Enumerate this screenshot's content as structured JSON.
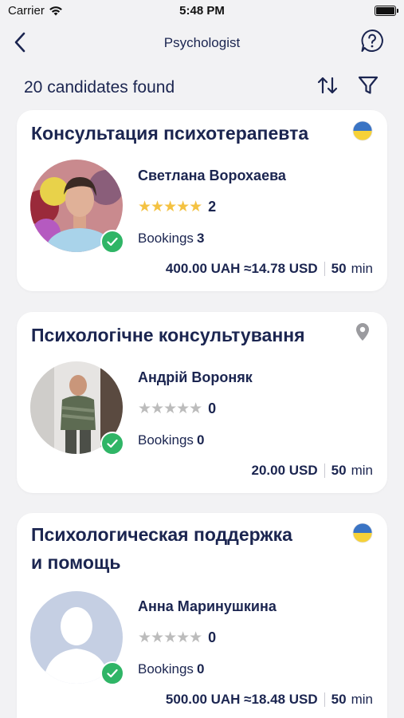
{
  "status_bar": {
    "carrier": "Carrier",
    "time": "5:48 PM"
  },
  "nav": {
    "title": "Psychologist"
  },
  "results": {
    "count_label": "20 candidates found"
  },
  "cards": [
    {
      "title": "Консультация психотерапевта",
      "badge": "ukraine-flag-icon",
      "name": "Светлана Ворохаева",
      "stars": 5,
      "reviews": "2",
      "bookings_label": "Bookings",
      "bookings_count": "3",
      "price": "400.00 UAH ≈14.78 USD",
      "duration": "50",
      "duration_unit": "min"
    },
    {
      "title": "Психологічне консультування",
      "badge": "location-pin-icon",
      "name": "Андрій Вороняк",
      "stars": 0,
      "reviews": "0",
      "bookings_label": "Bookings",
      "bookings_count": "0",
      "price": "20.00 USD",
      "duration": "50",
      "duration_unit": "min"
    },
    {
      "title_line1": "Психологическая поддержка",
      "title_line2": "и помощь",
      "badge": "ukraine-flag-icon",
      "name": "Анна Маринушкина",
      "stars": 0,
      "reviews": "0",
      "bookings_label": "Bookings",
      "bookings_count": "0",
      "price": "500.00 UAH ≈18.48 USD",
      "duration": "50",
      "duration_unit": "min"
    }
  ],
  "colors": {
    "accent_navy": "#1b2550",
    "verified_green": "#2fb566",
    "star_gold": "#f4c242",
    "star_empty": "#bcbcbc",
    "flag_blue": "#3a74c4",
    "flag_yellow": "#f6d138"
  }
}
